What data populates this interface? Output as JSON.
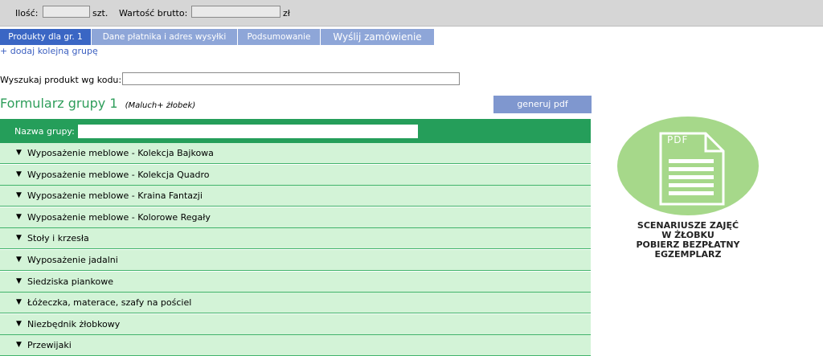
{
  "topbar": {
    "qty_label": "Ilość:",
    "qty_value": "",
    "qty_unit": "szt.",
    "value_label": "Wartość brutto:",
    "value_value": "",
    "value_unit": "zł"
  },
  "tabs": [
    {
      "label": "Produkty dla gr. 1",
      "active": true
    },
    {
      "label": "Dane płatnika i adres wysyłki",
      "active": false
    },
    {
      "label": "Podsumowanie",
      "active": false
    },
    {
      "label": "Wyślij zamówienie",
      "active": false
    }
  ],
  "add_group_link": "+ dodaj kolejną grupę",
  "search": {
    "label": "Wyszukaj produkt wg kodu:",
    "value": ""
  },
  "form": {
    "title": "Formularz grupy 1",
    "subtitle": "(Maluch+ żłobek)",
    "pdf_button": "generuj pdf",
    "group_name_label": "Nazwa grupy:",
    "group_name_value": ""
  },
  "categories": [
    {
      "label": "Wyposażenie meblowe - Kolekcja Bajkowa"
    },
    {
      "label": "Wyposażenie meblowe - Kolekcja Quadro"
    },
    {
      "label": "Wyposażenie meblowe - Kraina Fantazji"
    },
    {
      "label": "Wyposażenie meblowe - Kolorowe Regały"
    },
    {
      "label": "Stoły i krzesła"
    },
    {
      "label": "Wyposażenie jadalni"
    },
    {
      "label": "Siedziska piankowe"
    },
    {
      "label": "Łóżeczka, materace, szafy na pościel"
    },
    {
      "label": "Niezbędnik żłobkowy"
    },
    {
      "label": "Przewijaki"
    }
  ],
  "promo": {
    "icon_label": "PDF",
    "lines": [
      "SCENARIUSZE ZAJĘĆ",
      "W ŻŁOBKU",
      "POBIERZ BEZPŁATNY",
      "EGZEMPLARZ"
    ]
  },
  "colors": {
    "tab_active": "#3a66c4",
    "tab_inactive": "#8ea6d8",
    "group_header": "#259e5a",
    "category_bg": "#d3f3d7",
    "title_green": "#2f9e5b",
    "pdf_circle": "#a6d88a"
  }
}
